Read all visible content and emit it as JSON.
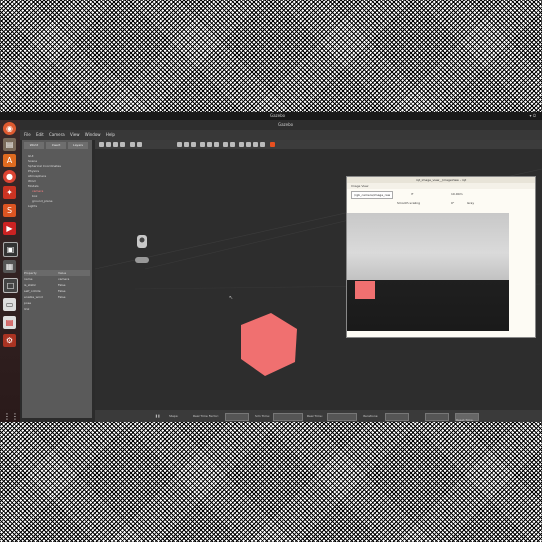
{
  "topbar": {
    "title": "Gazebo",
    "clock": ""
  },
  "gazebo": {
    "window_title": "Gazebo",
    "menu": [
      "File",
      "Edit",
      "Camera",
      "View",
      "Window",
      "Help"
    ],
    "panel_tabs": [
      "World",
      "Insert",
      "Layers"
    ],
    "tree": [
      "GUI",
      "Scene",
      "Spherical Coordinates",
      "Physics",
      "Atmosphere",
      "Wind",
      "Models",
      "camera",
      "box",
      "ground_plane",
      "Lights"
    ],
    "properties": {
      "header": [
        "Property",
        "Value"
      ],
      "rows": [
        [
          "name",
          "camera"
        ],
        [
          "is_static",
          "False"
        ],
        [
          "self_collide",
          "False"
        ],
        [
          "enable_wind",
          "False"
        ],
        [
          "pose",
          ""
        ],
        [
          "link",
          ""
        ]
      ]
    },
    "bottom": {
      "steps": "Steps:",
      "real_time_factor": "Real Time Factor:",
      "sim_time": "Sim Time:",
      "real_time": "Real Time:",
      "iterations": "Iterations:",
      "reset": "Reset Time"
    }
  },
  "image_view": {
    "window_title": "rqt_image_view__ImageView - rqt",
    "plugin_title": "Image View",
    "topic": "/rgb_camera/image_raw",
    "zoom": "10.00m",
    "smooth_label": "Smooth scaling",
    "rotation": "0°",
    "rotation_mode": "Gray"
  },
  "colors": {
    "cube": "#f07070",
    "accent": "#e85020"
  },
  "icons": [
    "ubuntu-logo-icon",
    "files-icon",
    "software-icon",
    "chrome-icon",
    "terminal-icon",
    "settings-icon",
    "apps-grid-icon"
  ]
}
